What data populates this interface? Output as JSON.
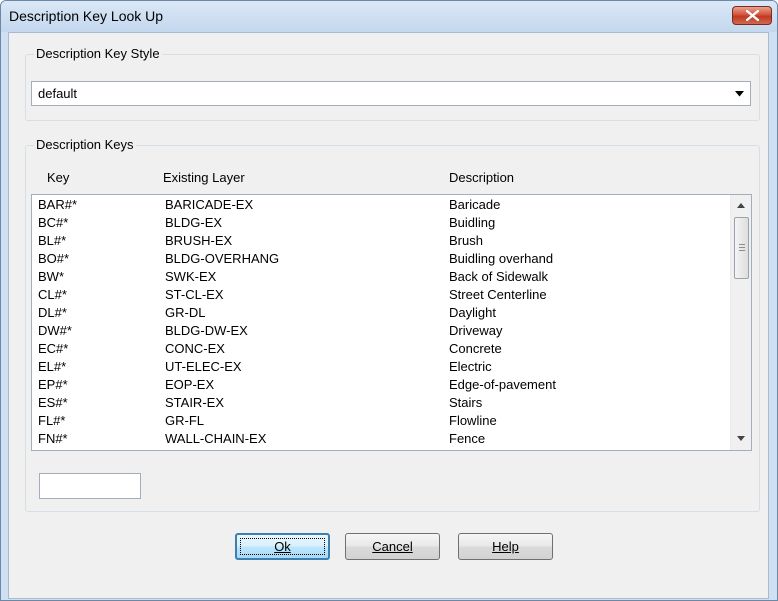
{
  "window": {
    "title": "Description Key Look Up"
  },
  "style_group": {
    "label": "Description Key Style",
    "selected": "default"
  },
  "keys_group": {
    "label": "Description Keys",
    "columns": [
      "Key",
      "Existing Layer",
      "Description"
    ],
    "rows": [
      [
        "BAR#*",
        "BARICADE-EX",
        "Baricade"
      ],
      [
        "BC#*",
        "BLDG-EX",
        "Buidling"
      ],
      [
        "BL#*",
        "BRUSH-EX",
        "Brush"
      ],
      [
        "BO#*",
        "BLDG-OVERHANG",
        "Buidling overhand"
      ],
      [
        "BW*",
        "SWK-EX",
        "Back of Sidewalk"
      ],
      [
        "CL#*",
        "ST-CL-EX",
        "Street Centerline"
      ],
      [
        "DL#*",
        "GR-DL",
        "Daylight"
      ],
      [
        "DW#*",
        "BLDG-DW-EX",
        "Driveway"
      ],
      [
        "EC#*",
        "CONC-EX",
        "Concrete"
      ],
      [
        "EL#*",
        "UT-ELEC-EX",
        "Electric"
      ],
      [
        "EP#*",
        "EOP-EX",
        "Edge-of-pavement"
      ],
      [
        "ES#*",
        "STAIR-EX",
        "Stairs"
      ],
      [
        "FL#*",
        "GR-FL",
        "Flowline"
      ],
      [
        "FN#*",
        "WALL-CHAIN-EX",
        "Fence"
      ]
    ],
    "filter_value": ""
  },
  "buttons": {
    "ok": "Ok",
    "cancel": "Cancel",
    "help": "Help"
  },
  "icons": {
    "close": "close-icon",
    "dropdown": "chevron-down-icon",
    "scroll_up": "scroll-up-icon",
    "scroll_down": "scroll-down-icon"
  },
  "colors": {
    "title_bar": "#c3d7ee",
    "close_button": "#c0381f",
    "default_button_border": "#3c7fb1"
  }
}
